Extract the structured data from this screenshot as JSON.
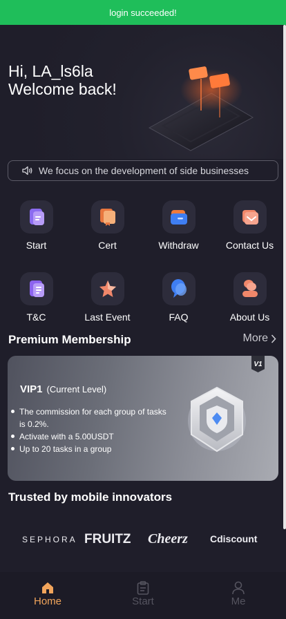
{
  "toast": {
    "text": "login succeeded!"
  },
  "greeting": {
    "line1": "Hi, LA_ls6la",
    "line2": "Welcome back!"
  },
  "notice": {
    "icon": "speaker-icon",
    "text": "We focus on the development of side businesses"
  },
  "menu": [
    {
      "label": "Start",
      "icon": "document-icon",
      "color": "#8b6cf0"
    },
    {
      "label": "Cert",
      "icon": "certificate-icon",
      "color": "#f0915a"
    },
    {
      "label": "Withdraw",
      "icon": "wallet-icon",
      "color": "#3f7ef2"
    },
    {
      "label": "Contact Us",
      "icon": "mail-icon",
      "color": "#f07a63"
    },
    {
      "label": "T&C",
      "icon": "terms-icon",
      "color": "#9a6cf2"
    },
    {
      "label": "Last Event",
      "icon": "star-icon",
      "color": "#f0876a"
    },
    {
      "label": "FAQ",
      "icon": "question-bubble-icon",
      "color": "#3f8af0"
    },
    {
      "label": "About Us",
      "icon": "people-icon",
      "color": "#f08a72"
    }
  ],
  "membership": {
    "title": "Premium Membership",
    "more": "More",
    "badge": "V1",
    "level": "VIP1",
    "level_note": "(Current Level)",
    "benefits": [
      "The commission for each group of tasks is 0.2%.",
      "Activate with a 5.00USDT",
      "Up to 20 tasks in a group"
    ]
  },
  "trusted": {
    "title": "Trusted by mobile innovators",
    "brands": [
      "SEPHORA",
      "FRUITZ",
      "Cheerz",
      "Cdiscount"
    ]
  },
  "tabs": {
    "home": "Home",
    "start": "Start",
    "me": "Me",
    "active": "Home"
  },
  "colors": {
    "accent": "#f1a45b",
    "toast": "#1fbe5a",
    "background": "#1f1e2a"
  }
}
